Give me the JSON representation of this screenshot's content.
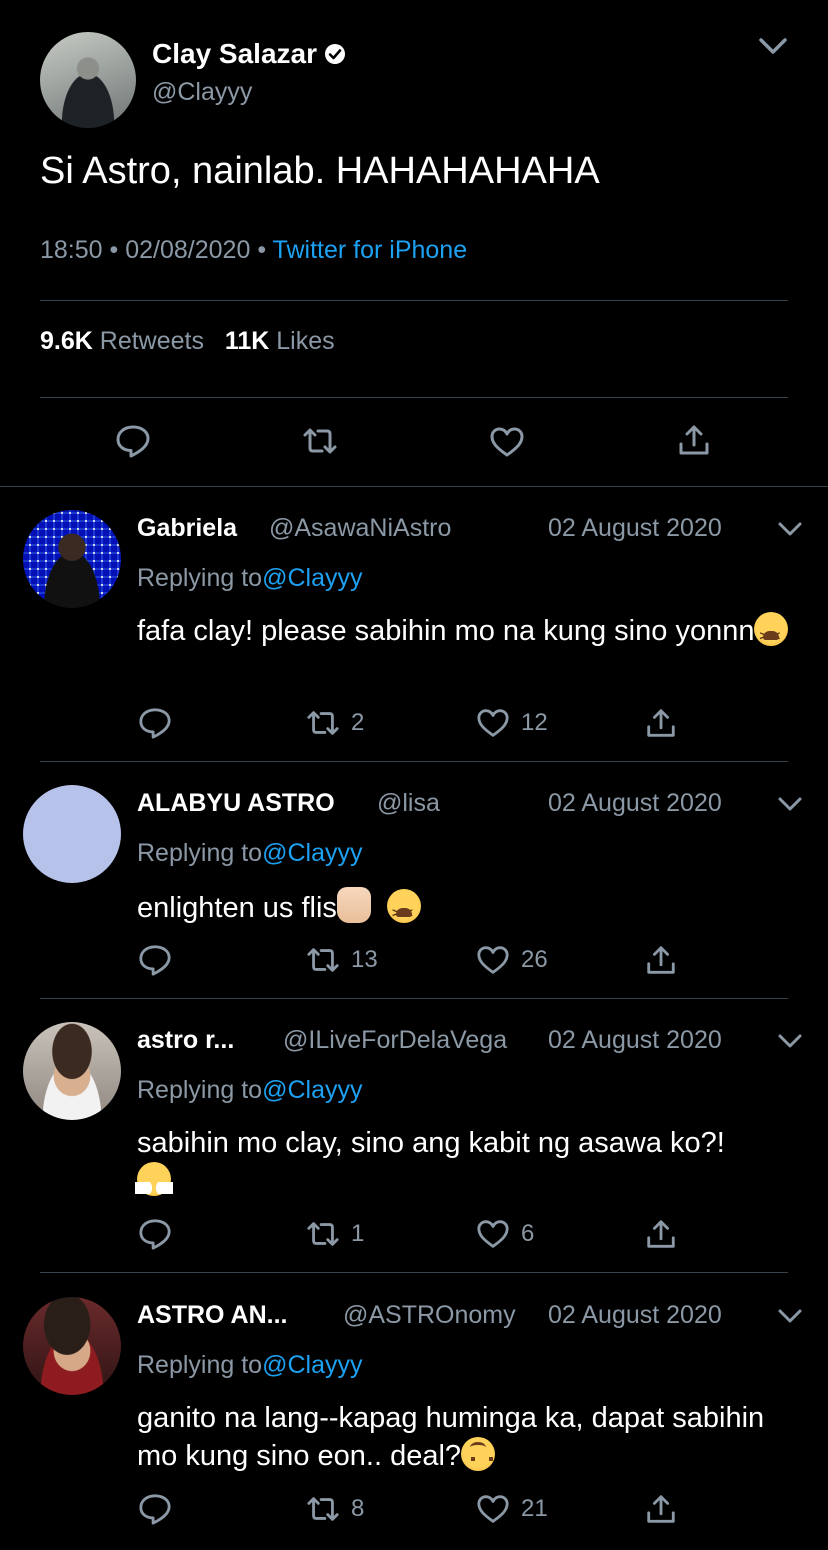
{
  "tweet": {
    "display_name": "Clay Salazar",
    "handle": "@Clayyy",
    "text": "Si Astro, nainlab. HAHAHAHAHA",
    "time": "18:50",
    "separator": "•",
    "date": "02/08/2020",
    "source": "Twitter for iPhone",
    "retweets_count": "9.6K",
    "retweets_label": "Retweets",
    "likes_count": "11K",
    "likes_label": "Likes",
    "icons": {
      "verified": "verified-badge-icon",
      "menu": "chevron-down-icon",
      "reply": "reply-icon",
      "retweet": "retweet-icon",
      "like": "heart-icon",
      "share": "share-icon"
    }
  },
  "replies": [
    {
      "name": "Gabriela",
      "handle": "@AsawaNiAstro",
      "date": "02 August 2020",
      "replying_prefix": "Replying to",
      "replying_to": "@Clayyy",
      "text": "fafa clay! please sabihin mo na kung sino yonnn",
      "emoji": [
        "weary-face-emoji"
      ],
      "retweets": "2",
      "likes": "12"
    },
    {
      "name": "ALABYU ASTRO",
      "handle": "@lisa",
      "date": "02 August 2020",
      "replying_prefix": "Replying to",
      "replying_to": "@Clayyy",
      "text": "enlighten us flis",
      "emoji": [
        "raised-fist-emoji",
        "weary-face-emoji"
      ],
      "retweets": "13",
      "likes": "26"
    },
    {
      "name": "astro r...",
      "handle": "@ILiveForDelaVega",
      "date": "02 August 2020",
      "replying_prefix": "Replying to",
      "replying_to": "@Clayyy",
      "text": "sabihin mo clay, sino ang kabit ng asawa ko?!",
      "emoji": [
        "face-with-steam-emoji"
      ],
      "retweets": "1",
      "likes": "6"
    },
    {
      "name": "ASTRO AN...",
      "handle": "@ASTROnomy",
      "date": "02 August 2020",
      "replying_prefix": "Replying to",
      "replying_to": "@Clayyy",
      "text": "ganito na lang--kapag huminga ka, dapat sabihin mo kung sino eon.. deal?",
      "emoji": [
        "upside-down-face-emoji"
      ],
      "retweets": "8",
      "likes": "21"
    }
  ],
  "colors": {
    "background": "#000000",
    "text": "#ffffff",
    "secondary": "#8b98a5",
    "link": "#1da1f2",
    "divider": "#38444d"
  }
}
